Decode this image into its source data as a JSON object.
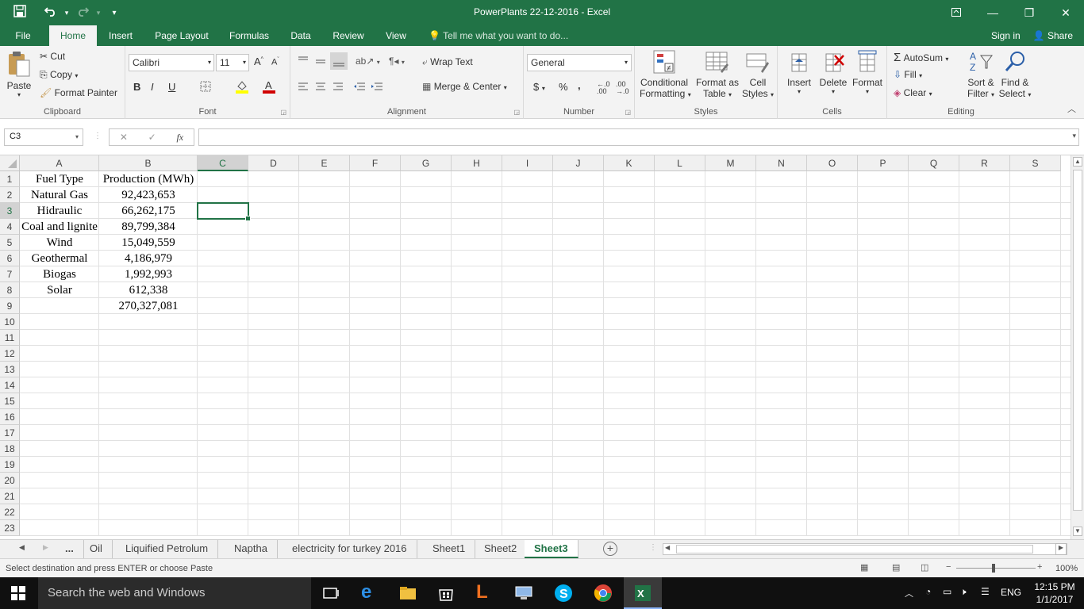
{
  "title": "PowerPlants 22-12-2016 - Excel",
  "qat": {
    "save": "💾",
    "undo": "↶",
    "redo": "↷",
    "customize": "▾"
  },
  "tabs": [
    "File",
    "Home",
    "Insert",
    "Page Layout",
    "Formulas",
    "Data",
    "Review",
    "View"
  ],
  "tell_me": "Tell me what you want to do...",
  "account": {
    "signin": "Sign in",
    "share": "Share"
  },
  "ribbon": {
    "clipboard": {
      "paste": "Paste",
      "cut": "Cut",
      "copy": "Copy",
      "format_painter": "Format Painter",
      "label": "Clipboard"
    },
    "font": {
      "name": "Calibri",
      "size": "11",
      "bold": "B",
      "italic": "I",
      "underline": "U",
      "label": "Font"
    },
    "alignment": {
      "wrap": "Wrap Text",
      "merge": "Merge & Center",
      "label": "Alignment"
    },
    "number": {
      "format": "General",
      "currency": "$",
      "percent": "%",
      "comma": ",",
      "label": "Number"
    },
    "styles": {
      "conditional": "Conditional",
      "conditional2": "Formatting",
      "format_as": "Format as",
      "format_as2": "Table",
      "cell": "Cell",
      "cell2": "Styles",
      "label": "Styles"
    },
    "cells": {
      "insert": "Insert",
      "delete": "Delete",
      "format": "Format",
      "label": "Cells"
    },
    "editing": {
      "autosum": "AutoSum",
      "fill": "Fill",
      "clear": "Clear",
      "sort": "Sort &",
      "sort2": "Filter",
      "find": "Find &",
      "find2": "Select",
      "label": "Editing"
    }
  },
  "formula_bar": {
    "name_box": "C3",
    "fx": "fx",
    "value": ""
  },
  "columns": [
    "A",
    "B",
    "C",
    "D",
    "E",
    "F",
    "G",
    "H",
    "I",
    "J",
    "K",
    "L",
    "M",
    "N",
    "O",
    "P",
    "Q",
    "R",
    "S"
  ],
  "rows": [
    "1",
    "2",
    "3",
    "4",
    "5",
    "6",
    "7",
    "8",
    "9",
    "10",
    "11",
    "12",
    "13",
    "14",
    "15",
    "16",
    "17",
    "18",
    "19",
    "20",
    "21",
    "22",
    "23"
  ],
  "sheet": {
    "A": [
      "Fuel Type",
      "Natural Gas",
      "Hidraulic",
      "Coal and lignite",
      "Wind",
      "Geothermal",
      "Biogas",
      "Solar",
      ""
    ],
    "B": [
      "Production (MWh)",
      "92,423,653",
      "66,262,175",
      "89,799,384",
      "15,049,559",
      "4,186,979",
      "1,992,993",
      "612,338",
      "270,327,081"
    ]
  },
  "sheet_tabs": [
    "...",
    "Oil",
    "Liquified Petrolum",
    "Naptha",
    "electricity for turkey 2016",
    "Sheet1",
    "Sheet2",
    "Sheet3"
  ],
  "active_sheet": "Sheet3",
  "status": {
    "message": "Select destination and press ENTER or choose Paste",
    "zoom": "100%"
  },
  "taskbar": {
    "search": "Search the web and Windows",
    "lang": "ENG",
    "time": "12:15 PM",
    "date": "1/1/2017"
  },
  "colors": {
    "accent": "#217346"
  }
}
